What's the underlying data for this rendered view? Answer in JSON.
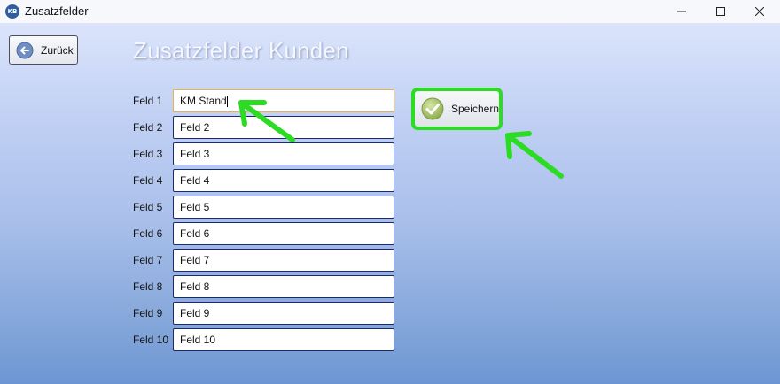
{
  "window": {
    "app_icon_text": "KB",
    "title": "Zusatzfelder",
    "controls": [
      "minimize-icon",
      "maximize-icon",
      "close-icon"
    ]
  },
  "toolbar": {
    "back_label": "Zurück",
    "back_icon": "arrow-left-circle-icon"
  },
  "page_title": "Zusatzfelder Kunden",
  "fields": [
    {
      "label": "Feld 1",
      "value": "KM Stand",
      "focused": true
    },
    {
      "label": "Feld 2",
      "value": "Feld 2"
    },
    {
      "label": "Feld 3",
      "value": "Feld 3"
    },
    {
      "label": "Feld 4",
      "value": "Feld 4"
    },
    {
      "label": "Feld 5",
      "value": "Feld 5"
    },
    {
      "label": "Feld 6",
      "value": "Feld 6"
    },
    {
      "label": "Feld 7",
      "value": "Feld 7"
    },
    {
      "label": "Feld 8",
      "value": "Feld 8"
    },
    {
      "label": "Feld 9",
      "value": "Feld 9"
    },
    {
      "label": "Feld 10",
      "value": "Feld 10"
    }
  ],
  "save": {
    "label": "Speichern",
    "icon": "checkmark-circle-icon"
  },
  "annotations": {
    "highlight_color": "#2cdc24",
    "arrow_icon": "green-arrow-icon"
  },
  "colors": {
    "background_top": "#dbe4fb",
    "background_bottom": "#6c96d3",
    "input_border": "#1b2a6a",
    "focus_border": "#e9b24c"
  }
}
